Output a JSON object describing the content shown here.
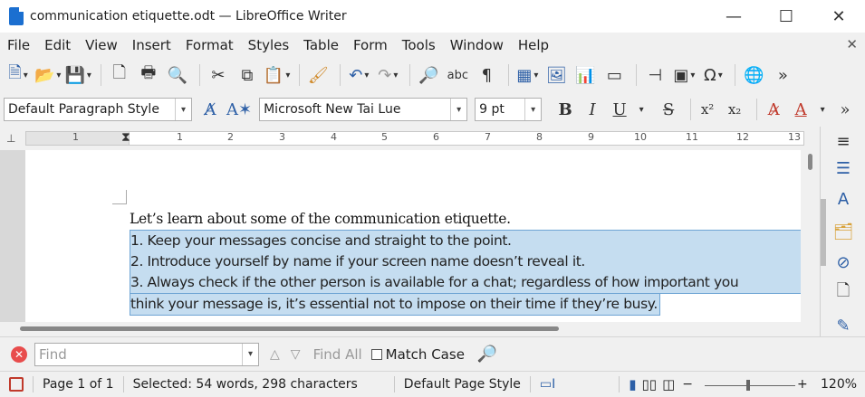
{
  "window": {
    "title": "communication etiquette.odt — LibreOffice Writer",
    "minimize": "—",
    "maximize": "☐",
    "close": "✕"
  },
  "menu": [
    "File",
    "Edit",
    "View",
    "Insert",
    "Format",
    "Styles",
    "Table",
    "Form",
    "Tools",
    "Window",
    "Help"
  ],
  "toolbar2": {
    "paragraph_style": "Default Paragraph Style",
    "font_name": "Microsoft New Tai Lue",
    "font_size": "9 pt",
    "bold": "B",
    "italic": "I",
    "underline": "U",
    "strike": "S",
    "superscript": "x²",
    "subscript": "x₂"
  },
  "ruler": {
    "labels": [
      "1",
      "1",
      "2",
      "3",
      "4",
      "5",
      "6",
      "7",
      "8",
      "9",
      "10",
      "11",
      "12",
      "13"
    ]
  },
  "document": {
    "heading_line": "Let’s learn about some of the communication etiquette.",
    "selected_lines": [
      "1. Keep your messages concise and straight to the point.",
      "2. Introduce yourself by name if your screen name doesn’t reveal it.",
      "3. Always check if the other person is available for a chat; regardless of how important you"
    ],
    "last_line": "think your message is, it’s essential not to impose on their time if they’re busy."
  },
  "findbar": {
    "placeholder": "Find",
    "find_all": "Find All",
    "match_case": "Match Case"
  },
  "status": {
    "page": "Page 1 of 1",
    "selection": "Selected: 54 words, 298 characters",
    "page_style": "Default Page Style",
    "zoom": "120%"
  },
  "colors": {
    "selection_fill": "#c5ddf0",
    "selection_border": "#6ea4d4",
    "accent": "#2d5fa6"
  }
}
